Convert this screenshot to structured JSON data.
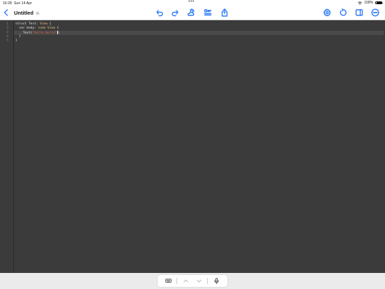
{
  "status": {
    "time": "16:28",
    "date": "Sun 14 Apr",
    "battery": "100%"
  },
  "document": {
    "title": "Untitled"
  },
  "icons": {
    "back": "chevron-left-icon",
    "undo": "undo-icon",
    "redo": "redo-icon",
    "theme": "sun-cloud-icon",
    "format": "format-list-icon",
    "share": "share-icon",
    "settings": "gear-icon",
    "refresh": "refresh-icon",
    "sidebar": "sidebar-icon",
    "more": "ellipsis-icon"
  },
  "editor": {
    "lines": [
      {
        "number": "1",
        "parts": [
          {
            "t": "struct Test: ",
            "c": "plain"
          },
          {
            "t": "View",
            "c": "type"
          },
          {
            "t": " {",
            "c": "plain"
          }
        ]
      },
      {
        "number": "2",
        "parts": [
          {
            "t": "  var body: ",
            "c": "plain"
          },
          {
            "t": "some View",
            "c": "kw"
          },
          {
            "t": " {",
            "c": "plain"
          }
        ]
      },
      {
        "number": "3",
        "parts": [
          {
            "t": "    Text(",
            "c": "plain"
          },
          {
            "t": "\"Hello World\"",
            "c": "str"
          },
          {
            "t": ")",
            "c": "plain"
          }
        ]
      },
      {
        "number": "4",
        "parts": [
          {
            "t": "  }",
            "c": "plain"
          }
        ]
      },
      {
        "number": "5",
        "parts": [
          {
            "t": "}",
            "c": "plain"
          }
        ]
      }
    ],
    "active_line": 3
  },
  "colors": {
    "accent": "#2f7cf6",
    "editor_bg": "#3b3b3b",
    "keyword": "#e6c07b",
    "string": "#d85a4c"
  }
}
